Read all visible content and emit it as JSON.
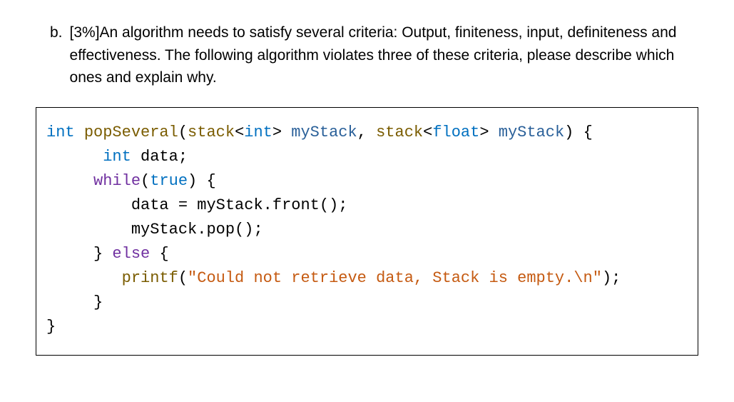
{
  "question": {
    "label": "b.",
    "text": "[3%]An algorithm needs to satisfy several criteria: Output, finiteness, input, definiteness and effectiveness. The following algorithm violates three of these criteria, please describe which ones and explain why."
  },
  "code": {
    "sig_int": "int",
    "sig_fn": "popSeveral",
    "sig_open": "(",
    "sig_stack1": "stack",
    "sig_lt1": "<",
    "sig_type1": "int",
    "sig_gt1": ">",
    "sig_param1": " myStack",
    "sig_comma": ", ",
    "sig_stack2": "stack",
    "sig_lt2": "<",
    "sig_type2": "float",
    "sig_gt2": ">",
    "sig_param2": " myStack",
    "sig_close": ")",
    "sig_brace": " {",
    "decl_indent": "      ",
    "decl_int": "int",
    "decl_var": " data;",
    "blank": "",
    "while_indent": "     ",
    "while_kw": "while",
    "while_open": "(",
    "while_true": "true",
    "while_close": ")",
    "while_brace": " {",
    "l1_indent": "         ",
    "l1_text": "data = myStack.front();",
    "l2_indent": "         ",
    "l2_text": "myStack.pop();",
    "else_indent": "     ",
    "else_close": "}",
    "else_kw": " else ",
    "else_brace": "{",
    "pf_indent": "        ",
    "pf_fn": "printf",
    "pf_open": "(",
    "pf_str": "\"Could not retrieve data, Stack is empty.\\n\"",
    "pf_close": ");",
    "inner_close_indent": "     ",
    "inner_close": "}",
    "outer_close": "}"
  }
}
